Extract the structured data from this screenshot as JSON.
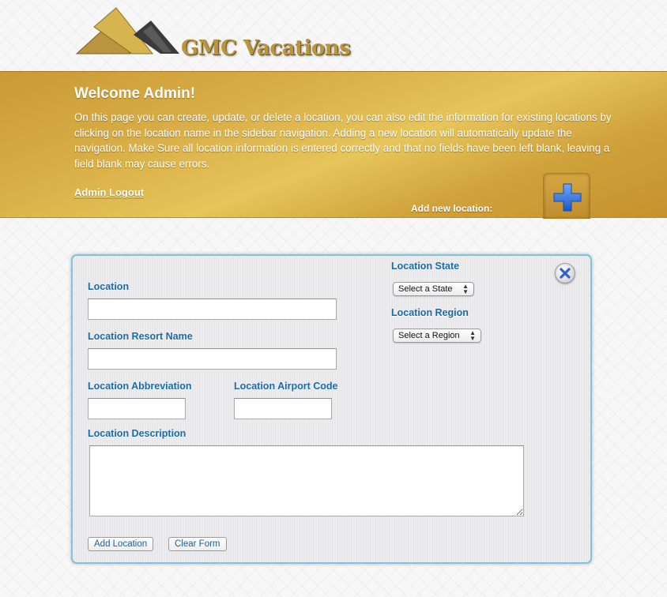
{
  "header": {
    "logo_text": "GMC Vacations"
  },
  "banner": {
    "welcome": "Welcome Admin!",
    "intro": "On this page you can create, update, or delete a location, you can also edit the information for existing locations by clicking on the location name in the sidebar navigation. Adding a new location will automatically update the navigation. Make Sure all location information is entered correctly and that no fields have been left blank, leaving a field blank may cause errors.",
    "logout_link": "Admin Logout",
    "add_new_label": "Add new location:"
  },
  "form": {
    "location_label": "Location",
    "location_value": "",
    "resort_label": "Location Resort Name",
    "resort_value": "",
    "abbreviation_label": "Location Abbreviation",
    "abbreviation_value": "",
    "airport_label": "Location Airport Code",
    "airport_value": "",
    "description_label": "Location Description",
    "description_value": "",
    "state_label": "Location State",
    "state_selected": "Select a State",
    "region_label": "Location Region",
    "region_selected": "Select a Region",
    "add_button": "Add Location",
    "clear_button": "Clear Form"
  },
  "colors": {
    "banner_gold": "#d8ad45",
    "label_blue": "#1a6aa8",
    "panel_border": "#7cc4dc",
    "plus_blue": "#2f6fd0"
  },
  "icons": {
    "add": "plus-icon",
    "close": "close-x-icon"
  }
}
